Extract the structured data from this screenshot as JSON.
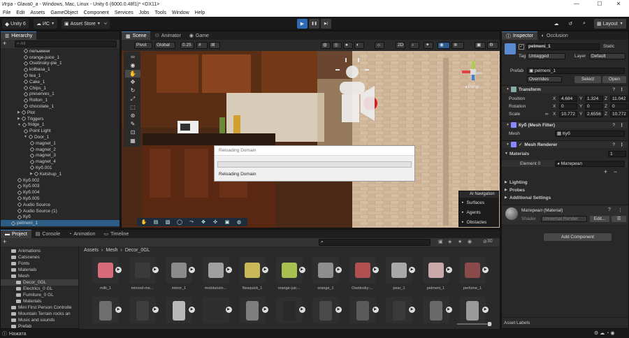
{
  "window": {
    "title": "Игра - Glava0_a - Windows, Mac, Linux - Unity 6 (6000.0.48f1)* <DX11>",
    "minimize": "—",
    "maximize": "☐",
    "close": "✕"
  },
  "menu": [
    "File",
    "Edit",
    "Assets",
    "GameObject",
    "Component",
    "Services",
    "Jobs",
    "Tools",
    "Window",
    "Help"
  ],
  "toolbar": {
    "unity": "Unity 6",
    "account": "ИС",
    "store": "Asset Store",
    "layout": "Layout",
    "play": "▶",
    "pause": "❚❚",
    "step": "▶|"
  },
  "hierarchy": {
    "tab": "Hierarchy",
    "search_placeholder": "All",
    "items": [
      {
        "label": "пельмени",
        "indent": 3,
        "type": "cube"
      },
      {
        "label": "orange-juice_1",
        "indent": 3,
        "type": "cube"
      },
      {
        "label": "Osetinsky-pie_1",
        "indent": 3,
        "type": "cube"
      },
      {
        "label": "kolbasa_1",
        "indent": 3,
        "type": "cube"
      },
      {
        "label": "tea_1",
        "indent": 3,
        "type": "cube"
      },
      {
        "label": "Cake_1",
        "indent": 3,
        "type": "cube"
      },
      {
        "label": "Chips_1",
        "indent": 3,
        "type": "cube"
      },
      {
        "label": "preserves_1",
        "indent": 3,
        "type": "cube"
      },
      {
        "label": "Rolton_1",
        "indent": 3,
        "type": "cube"
      },
      {
        "label": "chocolate_1",
        "indent": 3,
        "type": "cube"
      },
      {
        "label": "Plot",
        "indent": 2,
        "type": "arrow-cube"
      },
      {
        "label": "Triggers",
        "indent": 2,
        "type": "arrow-cube"
      },
      {
        "label": "fridge_1",
        "indent": 2,
        "type": "open-cube"
      },
      {
        "label": "Point Light",
        "indent": 3,
        "type": "cube"
      },
      {
        "label": "Door_1",
        "indent": 3,
        "type": "open-cube"
      },
      {
        "label": "magnet_1",
        "indent": 4,
        "type": "cube"
      },
      {
        "label": "magnet_2",
        "indent": 4,
        "type": "cube"
      },
      {
        "label": "magnet_3",
        "indent": 4,
        "type": "cube"
      },
      {
        "label": "magnet_4",
        "indent": 4,
        "type": "cube"
      },
      {
        "label": "Куб.001",
        "indent": 4,
        "type": "cube"
      },
      {
        "label": "Ketshup_1",
        "indent": 4,
        "type": "arrow-cube"
      },
      {
        "label": "Куб.002",
        "indent": 2,
        "type": "cube"
      },
      {
        "label": "Куб.003",
        "indent": 2,
        "type": "cube"
      },
      {
        "label": "Куб.004",
        "indent": 2,
        "type": "cube"
      },
      {
        "label": "Куб.005",
        "indent": 2,
        "type": "cube"
      },
      {
        "label": "Audio Source",
        "indent": 2,
        "type": "cube"
      },
      {
        "label": "Audio Source (1)",
        "indent": 2,
        "type": "cube"
      },
      {
        "label": "Куб",
        "indent": 2,
        "type": "cube"
      },
      {
        "label": "pelmeni_1",
        "indent": 1,
        "type": "cube",
        "selected": true
      }
    ]
  },
  "scene": {
    "tabs": [
      "Scene",
      "Animator",
      "Game"
    ],
    "pivot": "Pivot",
    "global": "Global",
    "snap": "0.25",
    "persp": "◂ Persp",
    "dialog": {
      "title": "Reloading Domain",
      "text": "Reloading Domain",
      "progress": 0.0
    },
    "ai_nav": {
      "title": "AI Navigation",
      "items": [
        "Surfaces",
        "Agents",
        "Obstacles"
      ]
    }
  },
  "project": {
    "tabs": [
      "Project",
      "Console",
      "Animation",
      "Timeline"
    ],
    "tree": [
      {
        "label": "Animations",
        "indent": 1
      },
      {
        "label": "Catscenes",
        "indent": 1
      },
      {
        "label": "Fonts",
        "indent": 1
      },
      {
        "label": "Materials",
        "indent": 1
      },
      {
        "label": "Mesh",
        "indent": 1,
        "open": true
      },
      {
        "label": "Decor_0GL",
        "indent": 2,
        "selected": true
      },
      {
        "label": "Electrics_0 GL",
        "indent": 2
      },
      {
        "label": "Furniture_0 GL",
        "indent": 2
      },
      {
        "label": "Materials",
        "indent": 2
      },
      {
        "label": "Mini First Person Controlle",
        "indent": 1
      },
      {
        "label": "Mountain Terrain rocks an",
        "indent": 1
      },
      {
        "label": "Music and sounds",
        "indent": 1
      },
      {
        "label": "Prefab",
        "indent": 1
      }
    ],
    "breadcrumb": [
      "Assets",
      "Mesh",
      "Decor_0GL"
    ],
    "count": "30",
    "assets_row1": [
      {
        "label": "milk_1",
        "color": "#d86b7a"
      },
      {
        "label": "minced-me...",
        "color": "#3a3a3a"
      },
      {
        "label": "mirror_1",
        "color": "#8a8a8a"
      },
      {
        "label": "moloturizin...",
        "color": "#a0a0a0"
      },
      {
        "label": "Nesquick_1",
        "color": "#c8b85a"
      },
      {
        "label": "orange-juic...",
        "color": "#a8c050"
      },
      {
        "label": "orange_1",
        "color": "#8e8e8e"
      },
      {
        "label": "Osetinsky-...",
        "color": "#b05050"
      },
      {
        "label": "pear_1",
        "color": "#a8a8a8"
      },
      {
        "label": "pelmeni_1",
        "color": "#c8a8a8"
      },
      {
        "label": "perfume_1",
        "color": "#8a4a4a"
      }
    ],
    "assets_row2_colors": [
      "#6e6e6e",
      "#3e3e3e",
      "#b8b8b8",
      "#2e2e2e",
      "#7e7e7e",
      "#2a2a2a",
      "#4a4a4a",
      "#5a5a5a",
      "#3a3a3a",
      "#6a6a6a",
      "#9a9a9a"
    ]
  },
  "inspector": {
    "tabs": [
      "Inspector",
      "Occlusion"
    ],
    "name": "pelmeni_1",
    "static": "Static",
    "tag_label": "Tag",
    "tag": "Untagged",
    "layer_label": "Layer",
    "layer": "Default",
    "prefab_label": "Prefab",
    "prefab": "pelmeni_1",
    "overrides": "Overrides",
    "select": "Select",
    "open": "Open",
    "transform": {
      "title": "Transform",
      "position_label": "Position",
      "position": {
        "x": "4.684",
        "y": "1.324",
        "z": "11.042"
      },
      "rotation_label": "Rotation",
      "rotation": {
        "x": "0",
        "y": "0",
        "z": "0"
      },
      "scale_label": "Scale",
      "scale": {
        "x": "10.772",
        "y": "2.6556",
        "z": "10.772"
      }
    },
    "mesh_filter": {
      "title": "Куб (Mesh Filter)",
      "mesh_label": "Mesh",
      "mesh": "Куб"
    },
    "mesh_renderer": {
      "title": "Mesh Renderer",
      "materials_label": "Materials",
      "materials_count": "1",
      "element_label": "Element 0",
      "element": "Материал"
    },
    "lighting": "Lighting",
    "probes": "Probes",
    "additional": "Additional Settings",
    "material": {
      "title": "Материал (Material)",
      "shader_label": "Shader",
      "shader": "Universal Render",
      "edit": "Edit..."
    },
    "add_component": "Add Component",
    "asset_labels": "Asset Labels"
  },
  "status": {
    "text": "Нажата"
  }
}
